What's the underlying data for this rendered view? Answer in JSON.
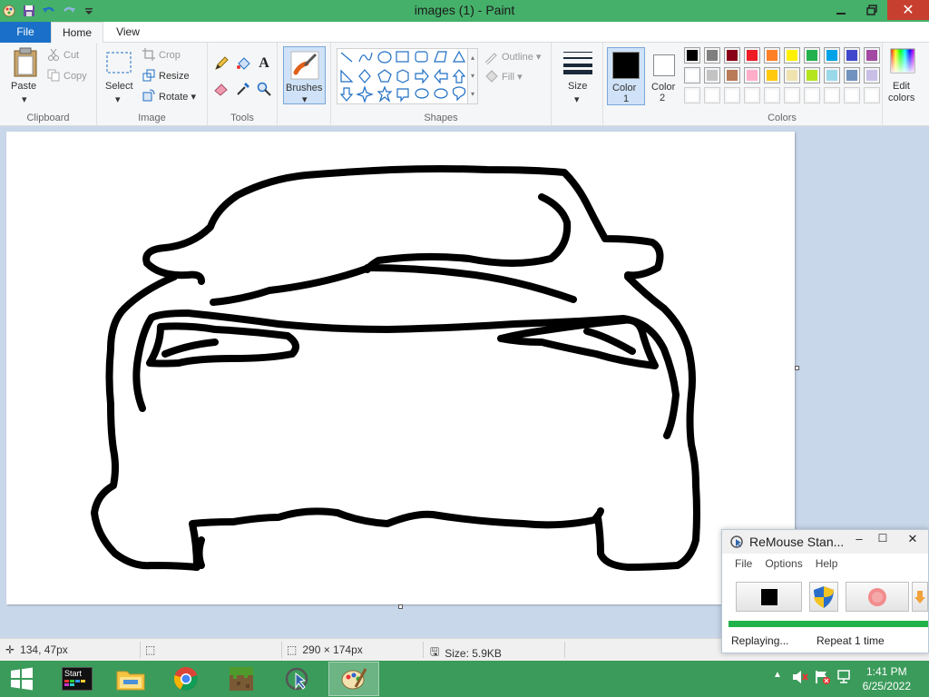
{
  "window": {
    "title": "images (1) - Paint"
  },
  "tabs": {
    "file": "File",
    "home": "Home",
    "view": "View"
  },
  "clipboard": {
    "paste": "Paste",
    "cut": "Cut",
    "copy": "Copy",
    "label": "Clipboard"
  },
  "image": {
    "select": "Select",
    "crop": "Crop",
    "resize": "Resize",
    "rotate": "Rotate",
    "label": "Image"
  },
  "tools": {
    "label": "Tools"
  },
  "brushes": {
    "label": "Brushes"
  },
  "shapes": {
    "outline": "Outline",
    "fill": "Fill",
    "label": "Shapes"
  },
  "size": {
    "label": "Size"
  },
  "color1": {
    "label": "Color",
    "num": "1",
    "value": "#000000"
  },
  "color2": {
    "label": "Color",
    "num": "2",
    "value": "#ffffff"
  },
  "colors": {
    "label": "Colors",
    "edit_label": "Edit",
    "edit_label2": "colors",
    "row1": [
      "#000000",
      "#7f7f7f",
      "#880015",
      "#ed1c24",
      "#ff7f27",
      "#fff200",
      "#22b14c",
      "#00a2e8",
      "#3f48cc",
      "#a349a4"
    ],
    "row2": [
      "#ffffff",
      "#c3c3c3",
      "#b97a57",
      "#ffaec9",
      "#ffc90e",
      "#efe4b0",
      "#b5e61d",
      "#99d9ea",
      "#7092be",
      "#c8bfe7"
    ]
  },
  "status": {
    "cursor_pos": "134, 47px",
    "image_size": "290 × 174px",
    "file_size": "Size: 5.9KB"
  },
  "remouse": {
    "title": "ReMouse Stan...",
    "menu_file": "File",
    "menu_options": "Options",
    "menu_help": "Help",
    "status": "Replaying...",
    "repeat": "Repeat 1 time",
    "progress": 1.0
  },
  "taskbar": {
    "start_label": "Start",
    "time": "1:41 PM",
    "date": "6/25/2022"
  }
}
